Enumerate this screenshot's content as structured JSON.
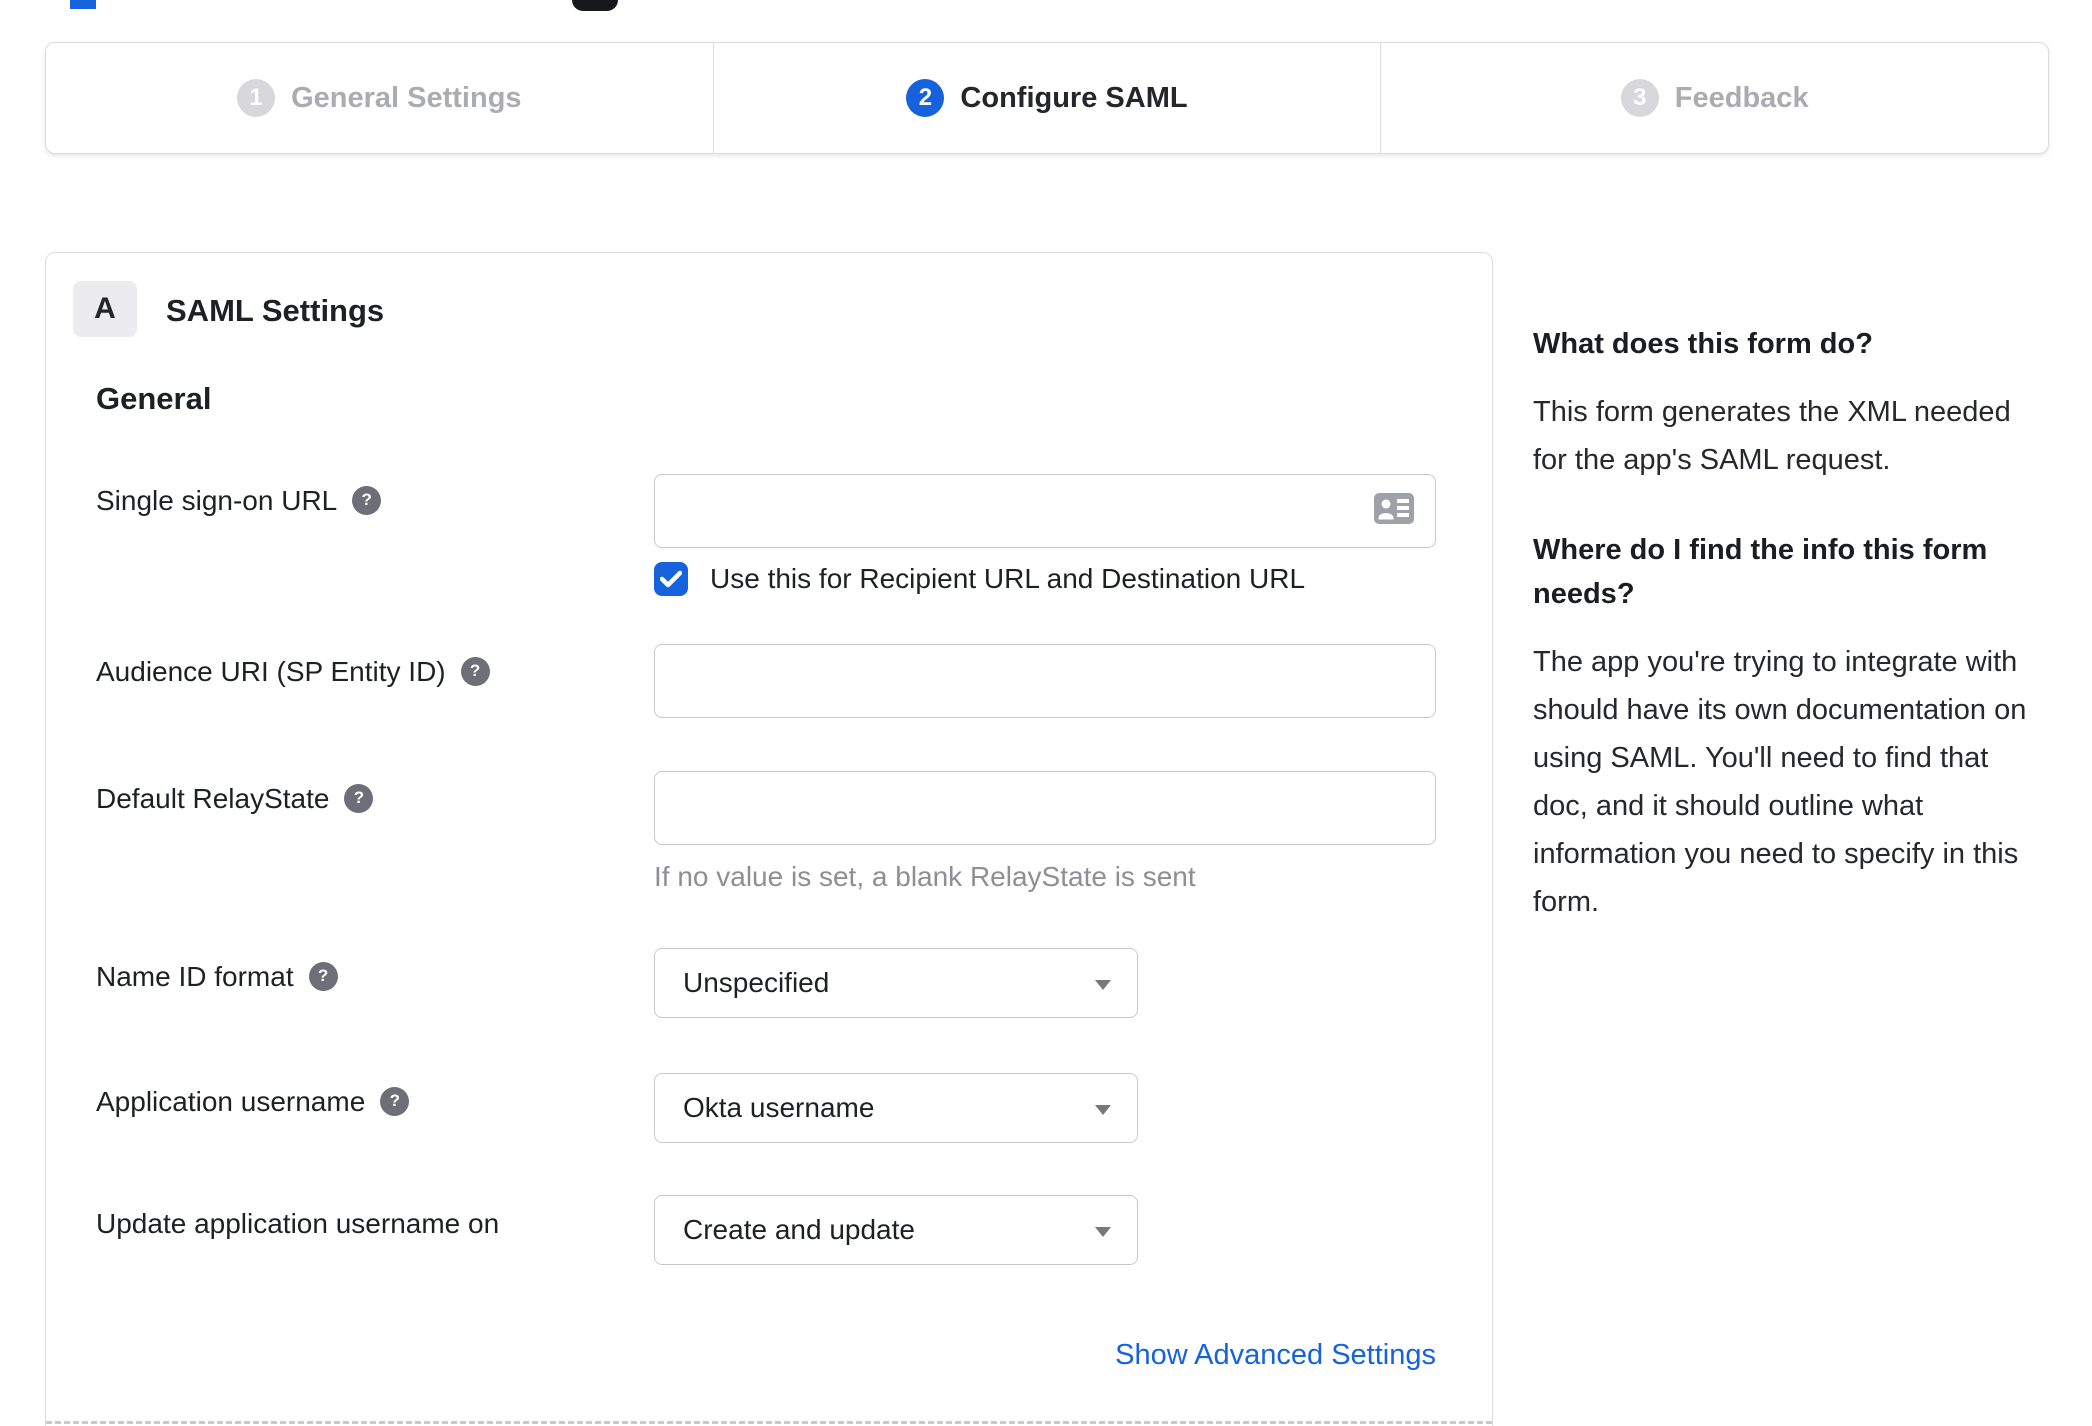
{
  "colors": {
    "accent_blue": "#1662dd",
    "inactive_gray": "#d7d7dc",
    "border_gray": "#dcdce0",
    "hint_gray": "#8e8e96"
  },
  "stepper": {
    "steps": [
      {
        "number": "1",
        "label": "General Settings",
        "state": "inactive"
      },
      {
        "number": "2",
        "label": "Configure SAML",
        "state": "active"
      },
      {
        "number": "3",
        "label": "Feedback",
        "state": "inactive"
      }
    ]
  },
  "panel": {
    "badge": "A",
    "title": "SAML Settings",
    "section_heading": "General",
    "fields": [
      {
        "label": "Single sign-on URL",
        "type": "text",
        "value": "",
        "checkbox_label": "Use this for Recipient URL and Destination URL",
        "checkbox_checked": true
      },
      {
        "label": "Audience URI (SP Entity ID)",
        "type": "text",
        "value": ""
      },
      {
        "label": "Default RelayState",
        "type": "text",
        "value": "",
        "hint": "If no value is set, a blank RelayState is sent"
      },
      {
        "label": "Name ID format",
        "type": "select",
        "value": "Unspecified"
      },
      {
        "label": "Application username",
        "type": "select",
        "value": "Okta username"
      },
      {
        "label": "Update application username on",
        "type": "select",
        "value": "Create and update"
      }
    ],
    "advanced_link": "Show Advanced Settings"
  },
  "sidebar": {
    "heading1": "What does this form do?",
    "para1": "This form generates the XML needed for the app's SAML request.",
    "heading2": "Where do I find the info this form needs?",
    "para2": "The app you're trying to integrate with should have its own documentation on using SAML. You'll need to find that doc, and it should outline what information you need to specify in this form."
  }
}
